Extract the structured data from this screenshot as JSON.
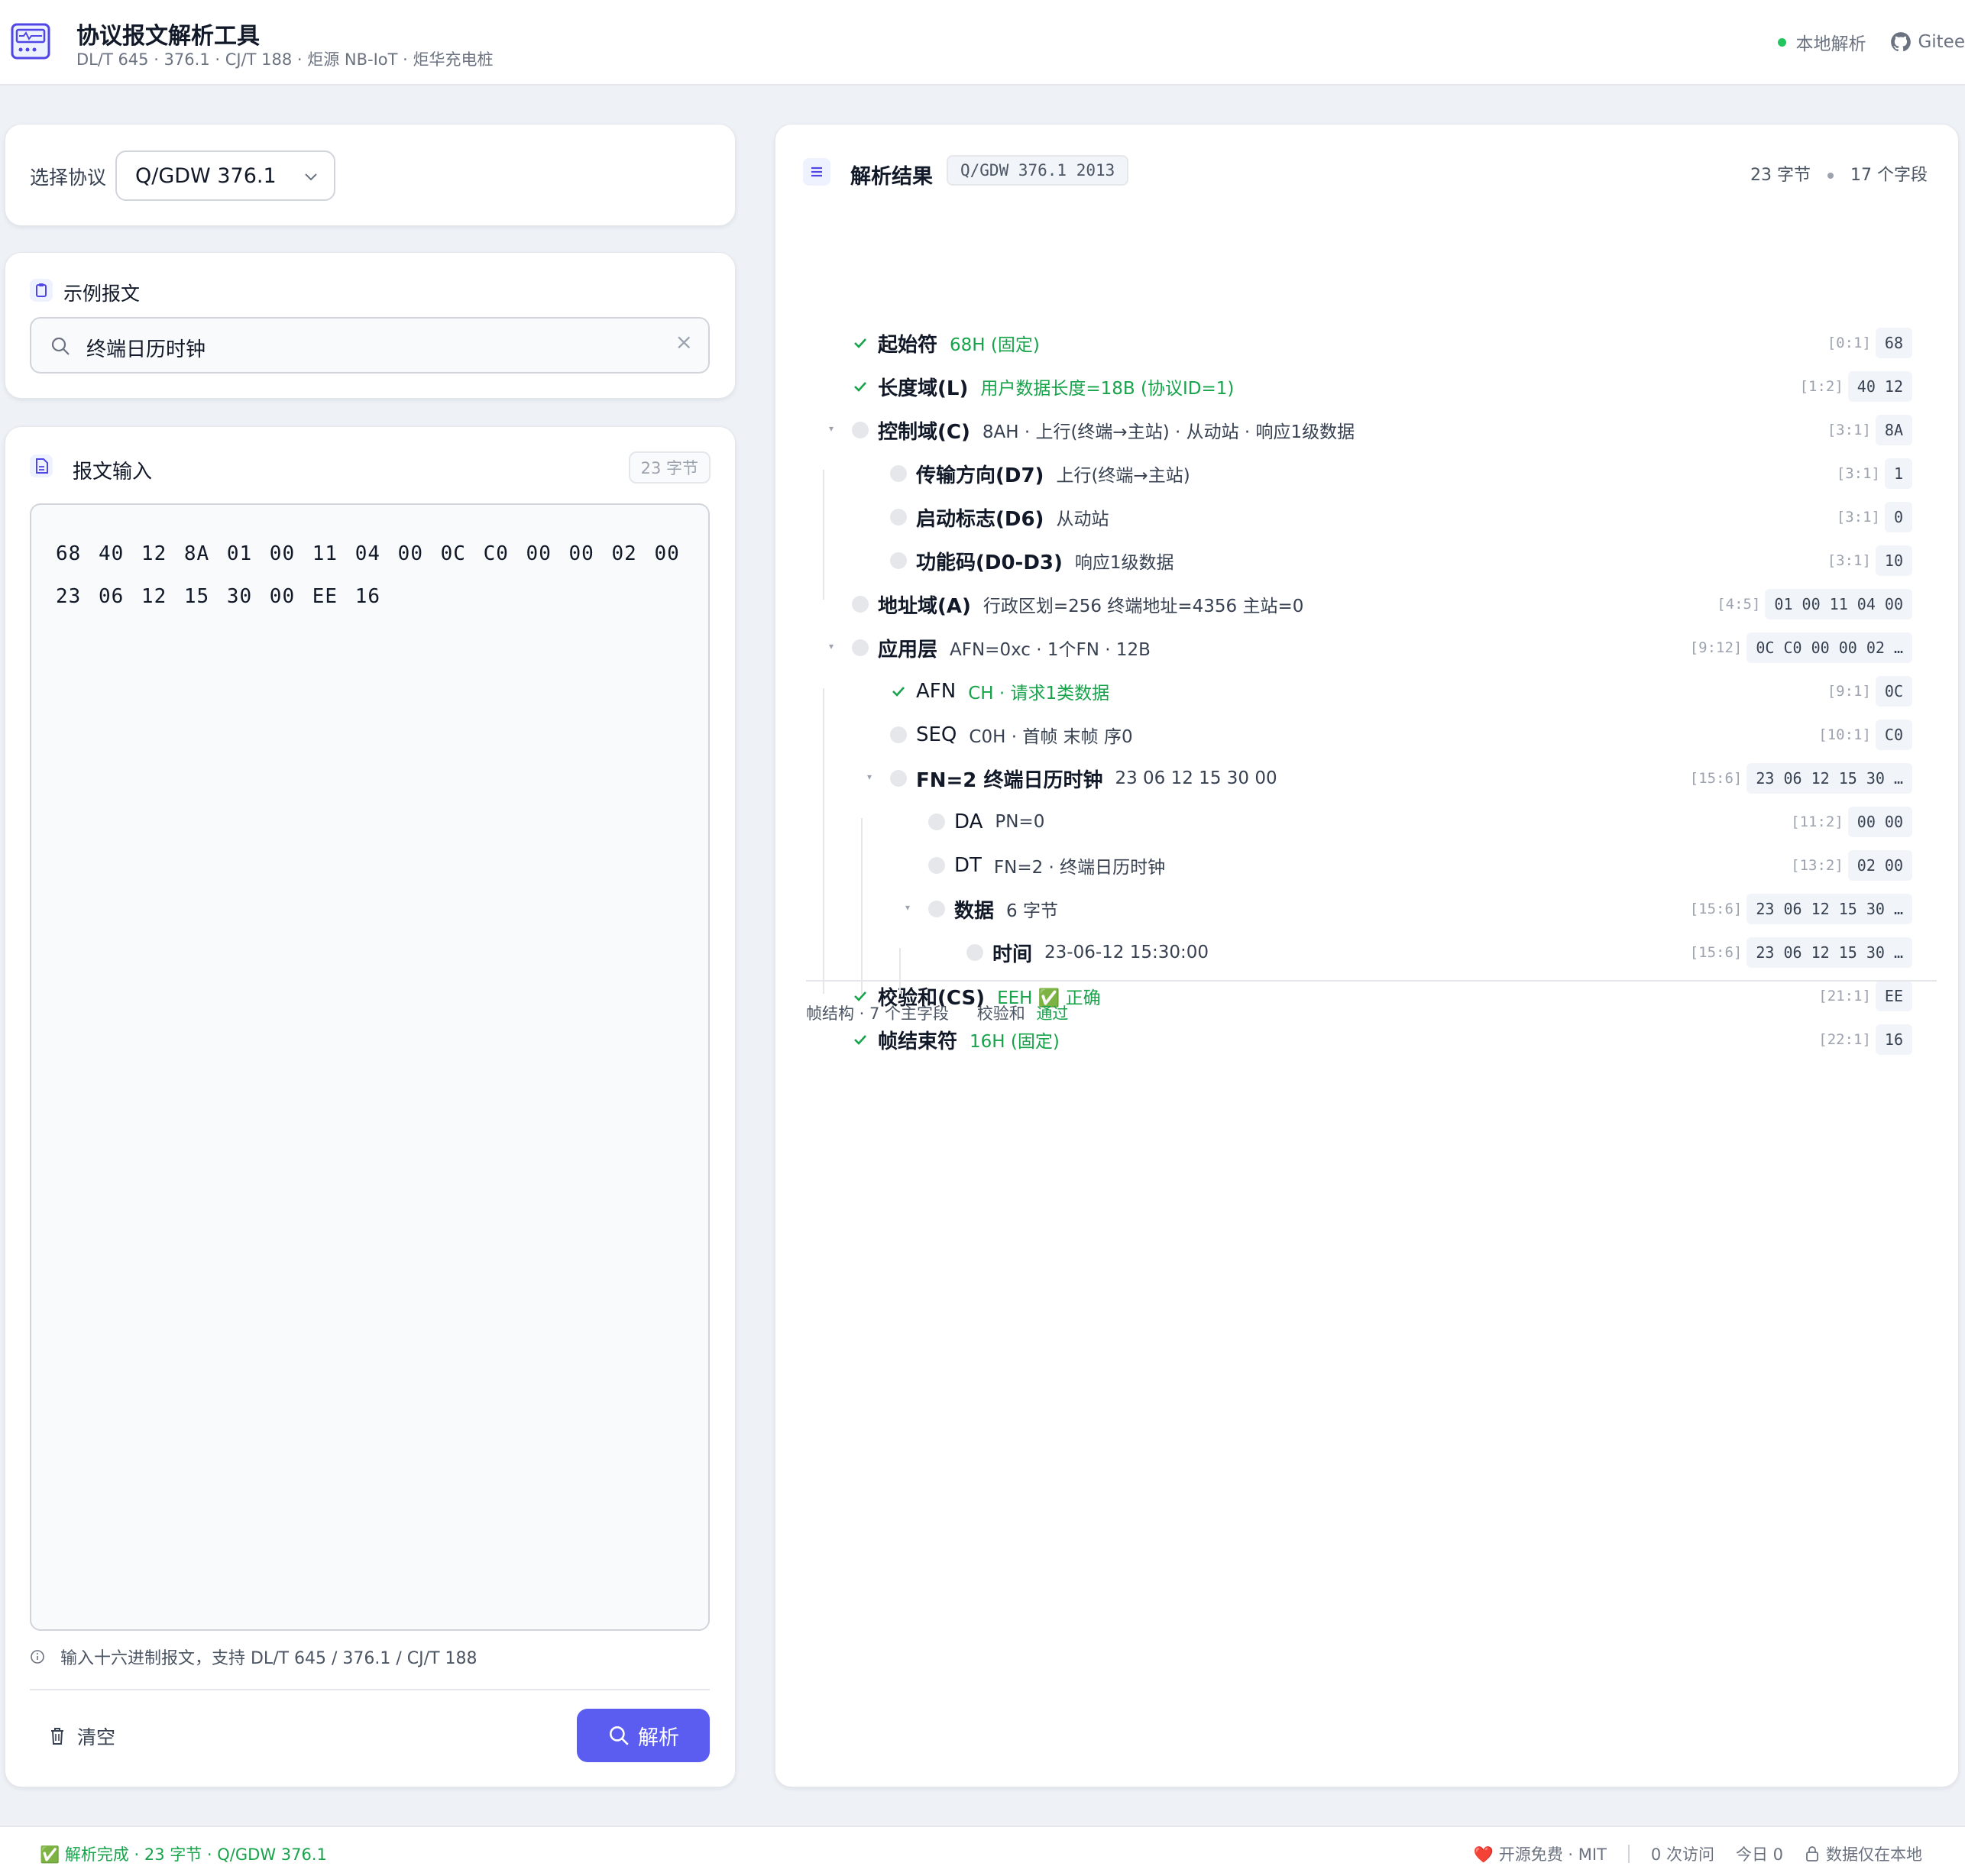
{
  "header": {
    "title": "协议报文解析工具",
    "subtitle": "DL/T 645 · 376.1 · CJ/T 188 · 炬源 NB-IoT · 炬华充电桩",
    "local_label": "本地解析",
    "gitee_label": "Gitee"
  },
  "protocol": {
    "label": "选择协议",
    "selected": "Q/GDW 376.1"
  },
  "example": {
    "title": "示例报文",
    "search_value": "终端日历时钟",
    "clear_icon": "×"
  },
  "input": {
    "title": "报文输入",
    "byte_count": "23 字节",
    "hex_text": "68 40 12 8A 01 00 11 04 00 0C C0 00 00 02 00 23 06 12 15 30 00 EE 16",
    "hint": "输入十六进制报文，支持 DL/T 645 / 376.1 / CJ/T 188",
    "clear_label": "清空",
    "parse_label": "解析"
  },
  "result": {
    "title": "解析结果",
    "tag": "Q/GDW 376.1 2013",
    "bytes": "23 字节",
    "fields": "17 个字段",
    "rows": [
      {
        "name": "起始符",
        "value": "68H (固定)",
        "range": "[0:1]",
        "hex": "68",
        "ok": true,
        "green": true,
        "bold": true
      },
      {
        "name": "长度域(L)",
        "value": "用户数据长度=18B (协议ID=1)",
        "range": "[1:2]",
        "hex": "40 12",
        "ok": true,
        "green": true,
        "bold": true
      },
      {
        "name": "控制域(C)",
        "value": "8AH · 上行(终端→主站) · 从动站 · 响应1级数据",
        "range": "[3:1]",
        "hex": "8A",
        "ok": false,
        "green": false,
        "bold": true
      },
      {
        "name": "传输方向(D7)",
        "value": "上行(终端→主站)",
        "range": "[3:1]",
        "hex": "1",
        "ok": false,
        "green": false,
        "bold": true
      },
      {
        "name": "启动标志(D6)",
        "value": "从动站",
        "range": "[3:1]",
        "hex": "0",
        "ok": false,
        "green": false,
        "bold": true
      },
      {
        "name": "功能码(D0-D3)",
        "value": "响应1级数据",
        "range": "[3:1]",
        "hex": "10",
        "ok": false,
        "green": false,
        "bold": true
      },
      {
        "name": "地址域(A)",
        "value": "行政区划=256 终端地址=4356 主站=0",
        "range": "[4:5]",
        "hex": "01 00 11 04 00",
        "ok": false,
        "green": false,
        "bold": true
      },
      {
        "name": "应用层",
        "value": "AFN=0xc · 1个FN · 12B",
        "range": "[9:12]",
        "hex": "0C C0 00 00 02 …",
        "ok": false,
        "green": false,
        "bold": true
      },
      {
        "name": "AFN",
        "value": "CH · 请求1类数据",
        "range": "[9:1]",
        "hex": "0C",
        "ok": true,
        "green": true,
        "bold": false
      },
      {
        "name": "SEQ",
        "value": "C0H · 首帧 末帧 序0",
        "range": "[10:1]",
        "hex": "C0",
        "ok": false,
        "green": false,
        "bold": false
      },
      {
        "name": "FN=2 终端日历时钟",
        "value": "23 06 12 15 30 00",
        "range": "[15:6]",
        "hex": "23 06 12 15 30 …",
        "ok": false,
        "green": false,
        "bold": true
      },
      {
        "name": "DA",
        "value": "PN=0",
        "range": "[11:2]",
        "hex": "00 00",
        "ok": false,
        "green": false,
        "bold": false
      },
      {
        "name": "DT",
        "value": "FN=2 · 终端日历时钟",
        "range": "[13:2]",
        "hex": "02 00",
        "ok": false,
        "green": false,
        "bold": false
      },
      {
        "name": "数据",
        "value": "6 字节",
        "range": "[15:6]",
        "hex": "23 06 12 15 30 …",
        "ok": false,
        "green": false,
        "bold": true
      },
      {
        "name": "时间",
        "value": "23-06-12 15:30:00",
        "range": "[15:6]",
        "hex": "23 06 12 15 30 …",
        "ok": false,
        "green": false,
        "bold": true
      },
      {
        "name": "校验和(CS)",
        "value": "EEH ✅ 正确",
        "range": "[21:1]",
        "hex": "EE",
        "ok": true,
        "green": true,
        "bold": true
      },
      {
        "name": "帧结束符",
        "value": "16H (固定)",
        "range": "[22:1]",
        "hex": "16",
        "ok": true,
        "green": true,
        "bold": true
      }
    ],
    "foot_structure": "帧结构 · 7 个主字段",
    "foot_checksum_label": "校验和",
    "foot_checksum_value": "通过"
  },
  "footer": {
    "status": "✅ 解析完成 · 23 字节 · Q/GDW 376.1",
    "license": "❤️ 开源免费 · MIT",
    "visits": "0 次访问",
    "today": "今日 0",
    "privacy": "数据仅在本地"
  },
  "colors": {
    "accent": "#5b5cf0",
    "success": "#16a34a",
    "background": "#eef2f7"
  }
}
